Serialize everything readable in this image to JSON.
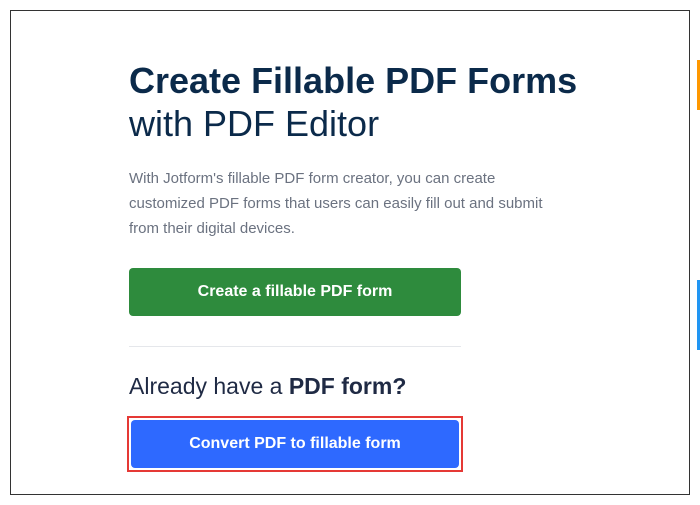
{
  "heading": {
    "line1": "Create Fillable PDF Forms",
    "line2": "with PDF Editor"
  },
  "description": "With Jotform's fillable PDF form creator, you can create customized PDF forms that users can easily fill out and submit from their digital devices.",
  "create_button": "Create a fillable PDF form",
  "subheading": {
    "prefix": "Already have a ",
    "bold": "PDF form?"
  },
  "convert_button": "Convert PDF to fillable form"
}
